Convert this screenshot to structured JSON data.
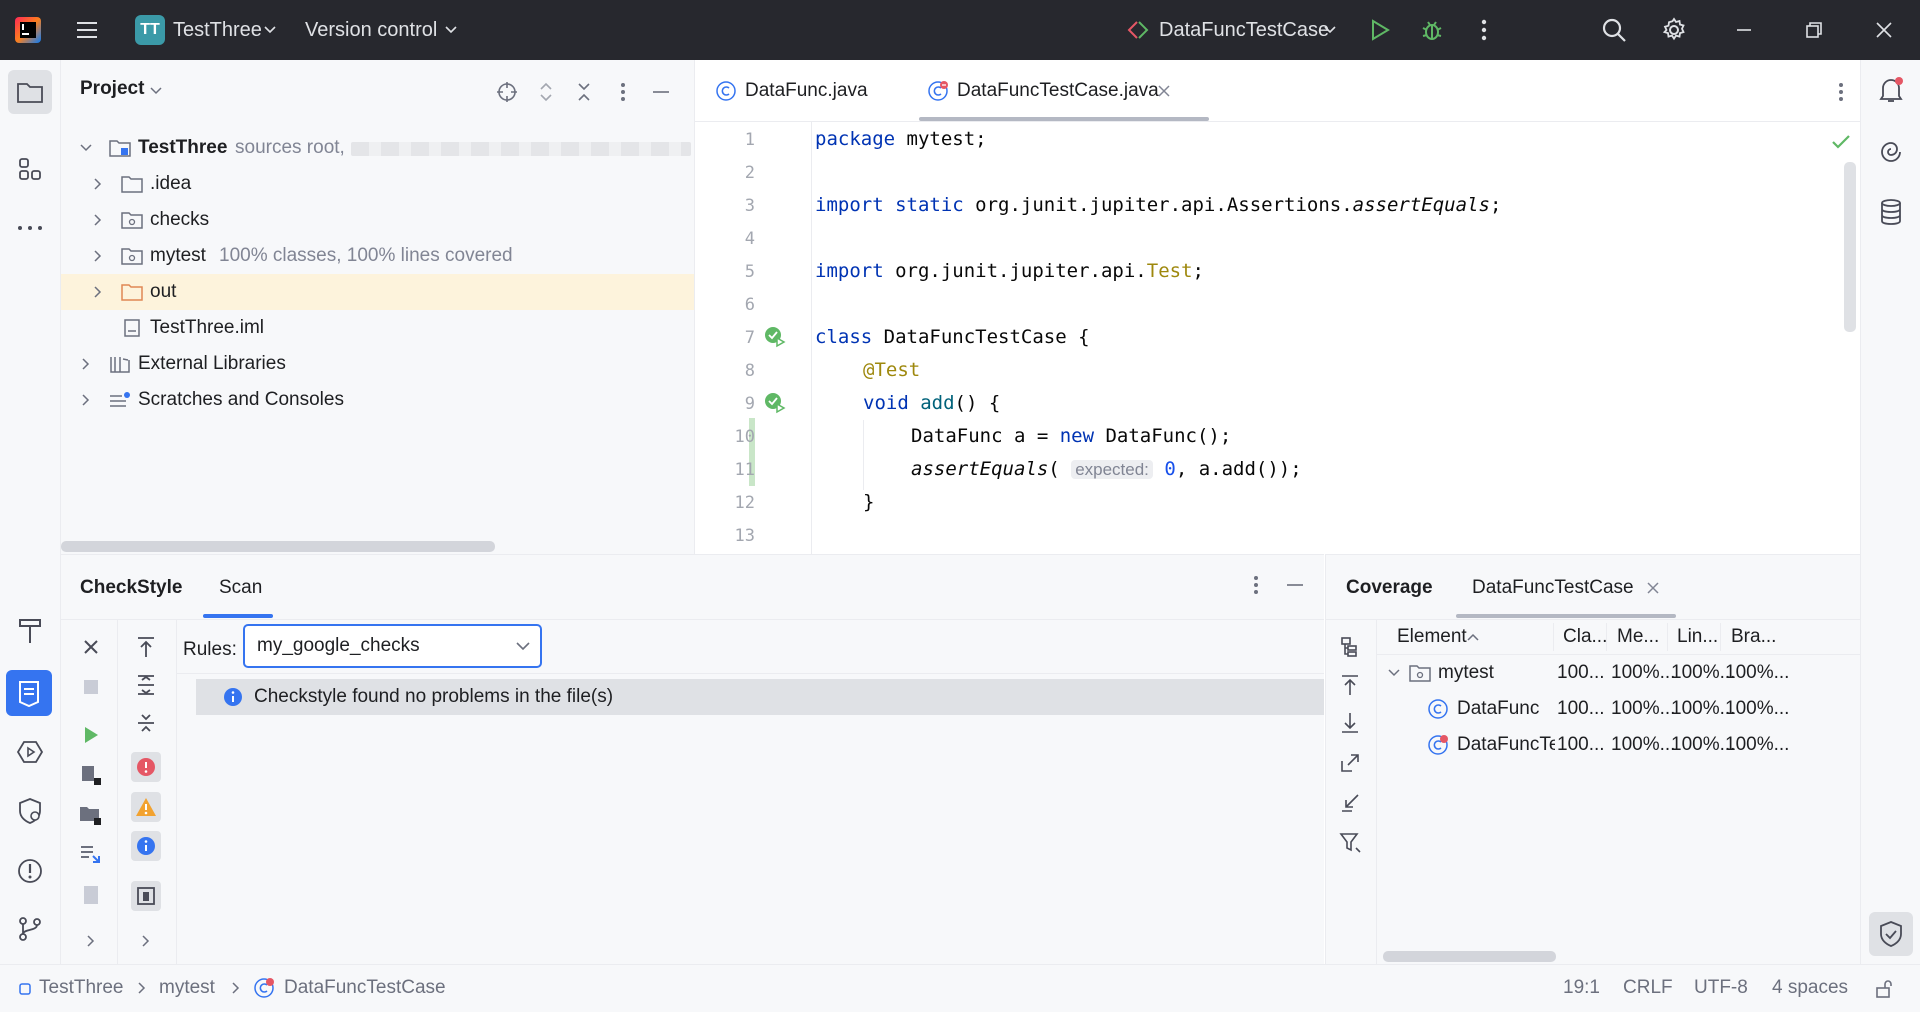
{
  "titlebar": {
    "project_badge": "TT",
    "project_name": "TestThree",
    "vcs_menu": "Version control",
    "run_config": "DataFuncTestCase"
  },
  "project_panel": {
    "title": "Project",
    "tree": [
      {
        "label": "TestThree",
        "note": "sources root,"
      },
      {
        "label": ".idea",
        "note": ""
      },
      {
        "label": "checks",
        "note": ""
      },
      {
        "label": "mytest",
        "note": "100% classes, 100% lines covered"
      },
      {
        "label": "out",
        "note": ""
      },
      {
        "label": "TestThree.iml",
        "note": ""
      },
      {
        "label": "External Libraries",
        "note": ""
      },
      {
        "label": "Scratches and Consoles",
        "note": ""
      }
    ]
  },
  "editor": {
    "tabs": [
      {
        "label": "DataFunc.java"
      },
      {
        "label": "DataFuncTestCase.java"
      }
    ],
    "line_numbers": [
      "1",
      "2",
      "3",
      "4",
      "5",
      "6",
      "7",
      "8",
      "9",
      "10",
      "11",
      "12",
      "13"
    ],
    "code": {
      "l1_kw": "package",
      "l1_rest": " mytest;",
      "l3_kw": "import static",
      "l3_rest": " org.junit.jupiter.api.Assertions.",
      "l3_it": "assertEquals",
      "l3_end": ";",
      "l5_kw": "import",
      "l5_rest": " org.junit.jupiter.api.",
      "l5_ann": "Test",
      "l5_end": ";",
      "l7_kw": "class",
      "l7_rest": " DataFuncTestCase {",
      "l8_ann": "@Test",
      "l9_kw": "void",
      "l9_fn": "add",
      "l9_rest": "() {",
      "l10_a": "DataFunc a = ",
      "l10_kw": "new",
      "l10_b": " DataFunc();",
      "l11_it": "assertEquals",
      "l11_a": "(",
      "l11_hint": "expected:",
      "l11_num": "0",
      "l11_b": ", a.add());",
      "l12": "}"
    }
  },
  "checkstyle": {
    "tabs": [
      "CheckStyle",
      "Scan"
    ],
    "rules_label": "Rules:",
    "rules_value": "my_google_checks",
    "message": "Checkstyle found no problems in the file(s)"
  },
  "coverage": {
    "title": "Coverage",
    "tab": "DataFuncTestCase",
    "columns": [
      "Element",
      "Cla...",
      "Me...",
      "Lin...",
      "Bra..."
    ],
    "rows": [
      {
        "name": "mytest",
        "cells": [
          "100...",
          "100%...",
          "100%...",
          "100%..."
        ]
      },
      {
        "name": "DataFunc",
        "cells": [
          "100...",
          "100%...",
          "100%...",
          "100%..."
        ]
      },
      {
        "name": "DataFuncTestC",
        "cells": [
          "100...",
          "100%...",
          "100%...",
          "100%..."
        ]
      }
    ]
  },
  "statusbar": {
    "crumbs": [
      "TestThree",
      "mytest",
      "DataFuncTestCase"
    ],
    "position": "19:1",
    "line_sep": "CRLF",
    "encoding": "UTF-8",
    "indent": "4 spaces"
  },
  "colors": {
    "accent": "#3574f0",
    "titlebar_bg": "#27282e",
    "run_green": "#5fb865",
    "selection": "#fdf3dc"
  }
}
